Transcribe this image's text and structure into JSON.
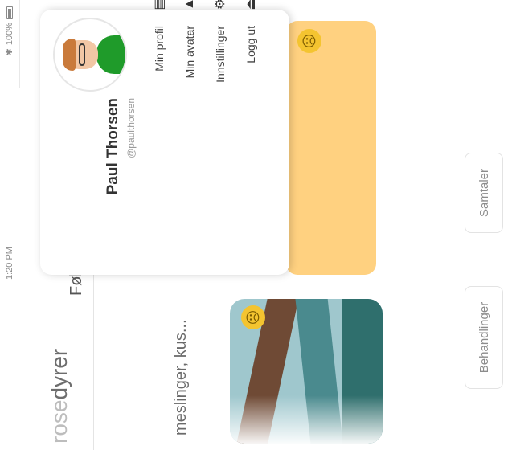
{
  "status": {
    "time": "1:20 PM",
    "battery": "100%"
  },
  "page": {
    "title_dim": "rose",
    "title_main": "dyrer",
    "tab_partial": "Føle",
    "description_partial": "meslinger, kus..."
  },
  "profile_menu": {
    "name": "Paul Thorsen",
    "handle": "@paulthorsen",
    "items": [
      {
        "label": "Min profil",
        "icon": "profile-icon"
      },
      {
        "label": "Min avatar",
        "icon": "avatar-icon"
      },
      {
        "label": "Innstillinger",
        "icon": "gear-icon"
      },
      {
        "label": "Logg ut",
        "icon": "logout-icon"
      }
    ]
  },
  "sidebar": {
    "buttons": [
      {
        "label": "Samtaler"
      },
      {
        "label": "Behandlinger"
      }
    ]
  },
  "colors": {
    "accent": "#ffd180",
    "avatar_shirt": "#1f9b2a"
  }
}
